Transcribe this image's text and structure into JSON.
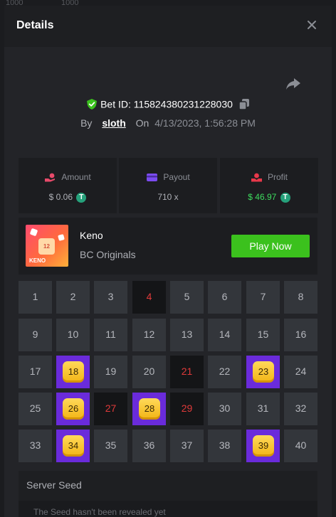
{
  "modal": {
    "title": "Details",
    "bet_label": "Bet ID:",
    "bet_id": "115824380231228030",
    "by_label": "By",
    "username": "sloth",
    "on_label": "On",
    "date": "4/13/2023, 1:56:28 PM"
  },
  "stats": {
    "amount": {
      "label": "Amount",
      "value": "$ 0.06",
      "icon": "hand-coin-icon"
    },
    "payout": {
      "label": "Payout",
      "value": "710 x",
      "icon": "card-icon"
    },
    "profit": {
      "label": "Profit",
      "value": "$ 46.97",
      "icon": "hand-coin-icon"
    }
  },
  "coin_symbol": "T",
  "game": {
    "name": "Keno",
    "provider": "BC Originals",
    "play_label": "Play Now",
    "thumb_number": "12",
    "thumb_text": "KENO"
  },
  "keno": {
    "numbers": [
      1,
      2,
      3,
      4,
      5,
      6,
      7,
      8,
      9,
      10,
      11,
      12,
      13,
      14,
      15,
      16,
      17,
      18,
      19,
      20,
      21,
      22,
      23,
      24,
      25,
      26,
      27,
      28,
      29,
      30,
      31,
      32,
      33,
      34,
      35,
      36,
      37,
      38,
      39,
      40
    ],
    "drawn_miss": [
      4,
      21,
      27,
      29
    ],
    "hits": [
      18,
      23,
      26,
      28,
      34,
      39
    ]
  },
  "seed": {
    "title": "Server Seed",
    "text": "The Seed hasn't been revealed yet"
  },
  "background": {
    "top_left": "1000",
    "top_mid": "1000"
  },
  "colors": {
    "accent_green": "#3bc11d",
    "profit_green": "#3ddc5e",
    "hit_purple": "#6a2bdb",
    "miss_red": "#e03a3a",
    "gem_gold": "#f2b414"
  }
}
